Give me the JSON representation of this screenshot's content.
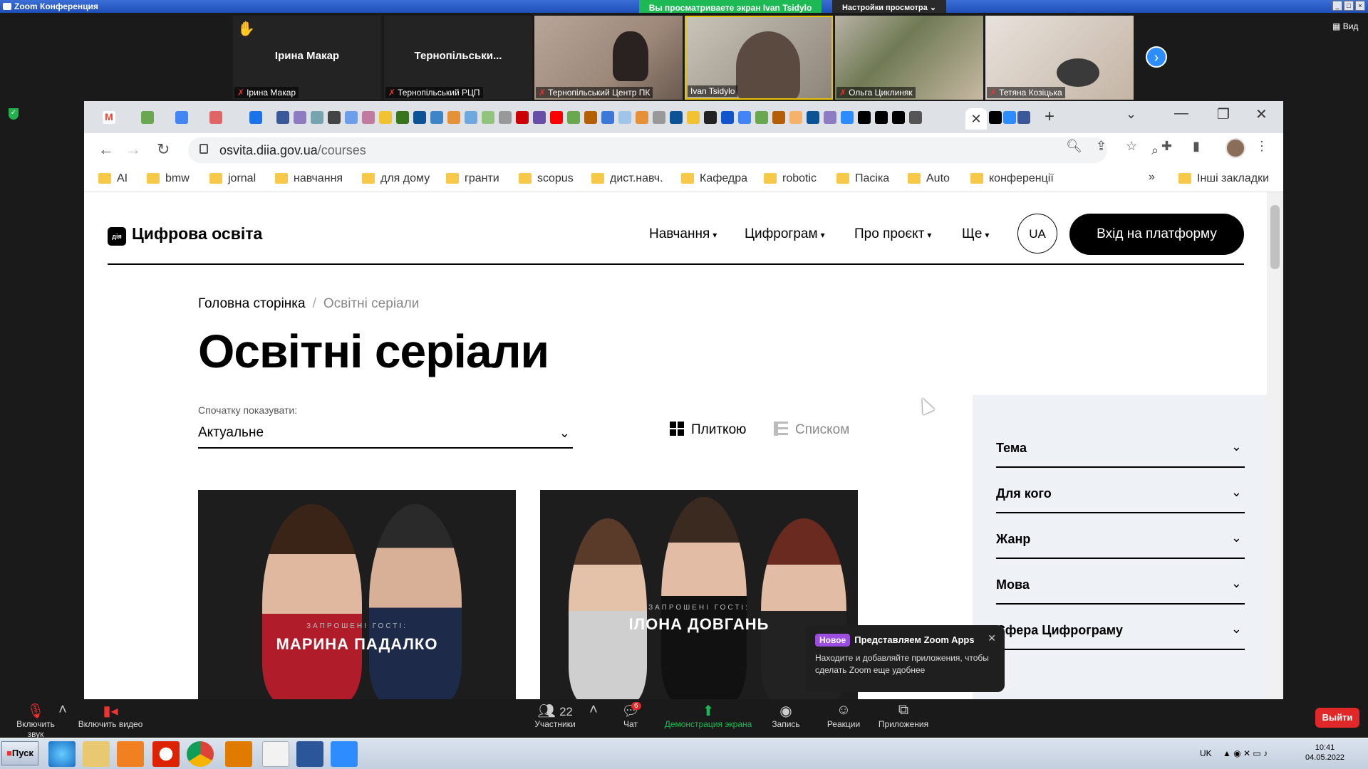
{
  "zoom": {
    "window_title": "Zoom Конференция",
    "share_banner": "Вы просматриваете экран Ivan Tsidylo",
    "view_options": "Настройки просмотра ⌄",
    "view_label": "Вид",
    "participants": [
      {
        "big_name": "Ірина Макар",
        "label": "Ірина Макар"
      },
      {
        "big_name": "Тернопільськи...",
        "label": "Тернопільський РЦП"
      },
      {
        "label": "Тернопільський Центр ПК"
      },
      {
        "label": "Ivan Tsidylo"
      },
      {
        "label": "Ольга Циклиняк"
      },
      {
        "label": "Тетяна Козіцька"
      }
    ],
    "toolbar": {
      "mute": "Включить звук",
      "video": "Включить видео",
      "participants": "Участники",
      "participants_count": "22",
      "chat": "Чат",
      "chat_badge": "6",
      "share": "Демонстрация экрана",
      "record": "Запись",
      "reactions": "Реакции",
      "apps": "Приложения",
      "leave": "Выйти"
    },
    "popup": {
      "badge": "Новое",
      "title": "Представляем Zoom Apps",
      "desc": "Находите и добавляйте приложения, чтобы сделать Zoom еще удобнее"
    }
  },
  "browser": {
    "url_host": "osvita.diia.gov.ua",
    "url_path": "/courses",
    "bookmarks": [
      "AI",
      "bmw",
      "jornal",
      "навчання",
      "для дому",
      "гранти",
      "scopus",
      "дист.навч.",
      "Кафедра",
      "robotic",
      "Пасіка",
      "Auto",
      "конференції"
    ],
    "other_bookmarks": "Інші закладки",
    "more": "»"
  },
  "site": {
    "logo_mark": "дія",
    "logo": "Цифрова освіта",
    "menu": [
      "Навчання",
      "Цифрограм",
      "Про проєкт",
      "Ще"
    ],
    "lang": "UA",
    "login": "Вхід на платформу",
    "breadcrumb_home": "Головна сторінка",
    "breadcrumb_sep": "/",
    "breadcrumb_current": "Освітні серіали",
    "title": "Освітні серіали",
    "sort_label": "Спочатку показувати:",
    "sort_value": "Актуальне",
    "view_tiles": "Плиткою",
    "view_list": "Списком",
    "cards": [
      {
        "guests": "ЗАПРОШЕНІ ГОСТІ:",
        "name": "МАРИНА ПАДАЛКО"
      },
      {
        "guests": "ЗАПРОШЕНІ ГОСТІ:",
        "name": "ІЛОНА ДОВГАНЬ"
      }
    ],
    "filters": [
      "Тема",
      "Для кого",
      "Жанр",
      "Мова",
      "Сфера Цифрограму"
    ]
  },
  "taskbar": {
    "start": "Пуск",
    "lang": "UK",
    "time": "10:41",
    "date": "04.05.2022"
  }
}
